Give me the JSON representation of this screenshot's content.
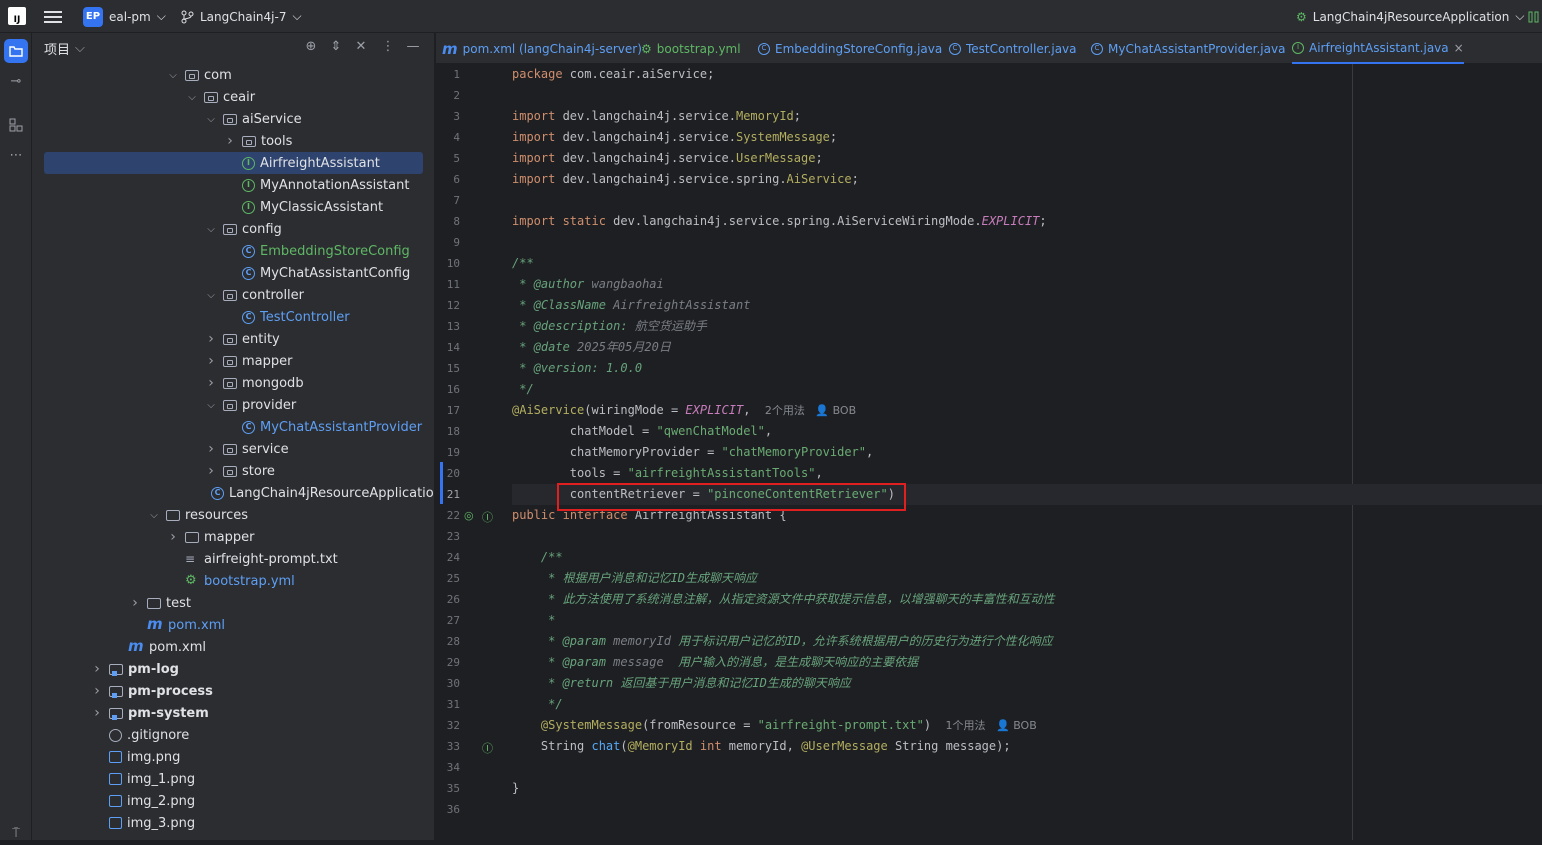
{
  "titlebar": {
    "logo": "IJ",
    "project_badge": "EP",
    "project_name": "eal-pm",
    "branch": "LangChain4j-7",
    "run_config": "LangChain4jResourceApplication"
  },
  "panel": {
    "title": "项目"
  },
  "tree": [
    {
      "label": "com",
      "type": "package",
      "indent": 1,
      "chev": "open"
    },
    {
      "label": "ceair",
      "type": "package",
      "indent": 2,
      "chev": "open"
    },
    {
      "label": "aiService",
      "type": "package",
      "indent": 3,
      "chev": "open"
    },
    {
      "label": "tools",
      "type": "package",
      "indent": 4,
      "chev": "closed"
    },
    {
      "label": "AirfreightAssistant",
      "type": "interface",
      "indent": 4,
      "chev": "none",
      "selected": true
    },
    {
      "label": "MyAnnotationAssistant",
      "type": "interface",
      "indent": 4,
      "chev": "none"
    },
    {
      "label": "MyClassicAssistant",
      "type": "interface",
      "indent": 4,
      "chev": "none"
    },
    {
      "label": "config",
      "type": "package",
      "indent": 3,
      "chev": "open"
    },
    {
      "label": "EmbeddingStoreConfig",
      "type": "class",
      "indent": 4,
      "chev": "none",
      "color": "green"
    },
    {
      "label": "MyChatAssistantConfig",
      "type": "class",
      "indent": 4,
      "chev": "none"
    },
    {
      "label": "controller",
      "type": "package",
      "indent": 3,
      "chev": "open"
    },
    {
      "label": "TestController",
      "type": "class",
      "indent": 4,
      "chev": "none",
      "color": "blue"
    },
    {
      "label": "entity",
      "type": "package",
      "indent": 3,
      "chev": "closed"
    },
    {
      "label": "mapper",
      "type": "package",
      "indent": 3,
      "chev": "closed"
    },
    {
      "label": "mongodb",
      "type": "package",
      "indent": 3,
      "chev": "closed"
    },
    {
      "label": "provider",
      "type": "package",
      "indent": 3,
      "chev": "open"
    },
    {
      "label": "MyChatAssistantProvider",
      "type": "class",
      "indent": 4,
      "chev": "none",
      "color": "blue"
    },
    {
      "label": "service",
      "type": "package",
      "indent": 3,
      "chev": "closed"
    },
    {
      "label": "store",
      "type": "package",
      "indent": 3,
      "chev": "closed"
    },
    {
      "label": "LangChain4jResourceApplication",
      "type": "class",
      "indent": 3,
      "chev": "none"
    },
    {
      "label": "resources",
      "type": "folder",
      "indent": 0,
      "chev": "open"
    },
    {
      "label": "mapper",
      "type": "folder",
      "indent": 1,
      "chev": "closed"
    },
    {
      "label": "airfreight-prompt.txt",
      "type": "txt",
      "indent": 1,
      "chev": "none"
    },
    {
      "label": "bootstrap.yml",
      "type": "yml",
      "indent": 1,
      "chev": "none",
      "color": "blue"
    },
    {
      "label": "test",
      "type": "folder",
      "indent": -1,
      "chev": "closed"
    },
    {
      "label": "pom.xml",
      "type": "maven",
      "indent": -1,
      "chev": "none",
      "color": "blue"
    },
    {
      "label": "pom.xml",
      "type": "maven",
      "indent": -2,
      "chev": "none"
    },
    {
      "label": "pm-log",
      "type": "module",
      "indent": -3,
      "chev": "closed",
      "bold": true
    },
    {
      "label": "pm-process",
      "type": "module",
      "indent": -3,
      "chev": "closed",
      "bold": true
    },
    {
      "label": "pm-system",
      "type": "module",
      "indent": -3,
      "chev": "closed",
      "bold": true
    },
    {
      "label": ".gitignore",
      "type": "git",
      "indent": -3,
      "chev": "none"
    },
    {
      "label": "img.png",
      "type": "image",
      "indent": -3,
      "chev": "none"
    },
    {
      "label": "img_1.png",
      "type": "image",
      "indent": -3,
      "chev": "none"
    },
    {
      "label": "img_2.png",
      "type": "image",
      "indent": -3,
      "chev": "none"
    },
    {
      "label": "img_3.png",
      "type": "image",
      "indent": -3,
      "chev": "none"
    }
  ],
  "tabs": [
    {
      "label": "pom.xml (langChain4j-server)",
      "icon": "maven"
    },
    {
      "label": "bootstrap.yml",
      "icon": "yml"
    },
    {
      "label": "EmbeddingStoreConfig.java",
      "icon": "class"
    },
    {
      "label": "TestController.java",
      "icon": "class"
    },
    {
      "label": "MyChatAssistantProvider.java",
      "icon": "class"
    },
    {
      "label": "AirfreightAssistant.java",
      "icon": "interface",
      "active": true
    }
  ],
  "code_lines": [
    [
      {
        "t": "package",
        "c": "kw"
      },
      {
        "t": " com.ceair.aiService;"
      }
    ],
    [],
    [
      {
        "t": "import",
        "c": "kw"
      },
      {
        "t": " dev.langchain4j.service."
      },
      {
        "t": "MemoryId",
        "c": "an"
      },
      {
        "t": ";"
      }
    ],
    [
      {
        "t": "import",
        "c": "kw"
      },
      {
        "t": " dev.langchain4j.service."
      },
      {
        "t": "SystemMessage",
        "c": "an"
      },
      {
        "t": ";"
      }
    ],
    [
      {
        "t": "import",
        "c": "kw"
      },
      {
        "t": " dev.langchain4j.service."
      },
      {
        "t": "UserMessage",
        "c": "an"
      },
      {
        "t": ";"
      }
    ],
    [
      {
        "t": "import",
        "c": "kw"
      },
      {
        "t": " dev.langchain4j.service.spring."
      },
      {
        "t": "AiService",
        "c": "an"
      },
      {
        "t": ";"
      }
    ],
    [],
    [
      {
        "t": "import static",
        "c": "kw"
      },
      {
        "t": " dev.langchain4j.service.spring.AiServiceWiringMode."
      },
      {
        "t": "EXPLICIT",
        "c": "it"
      },
      {
        "t": ";"
      }
    ],
    [],
    [
      {
        "t": "/**",
        "c": "cd"
      }
    ],
    [
      {
        "t": " * ",
        "c": "cd"
      },
      {
        "t": "@author",
        "c": "cd"
      },
      {
        "t": " wangbaohai",
        "c": "cm"
      }
    ],
    [
      {
        "t": " * ",
        "c": "cd"
      },
      {
        "t": "@ClassName",
        "c": "cd"
      },
      {
        "t": " AirfreightAssistant",
        "c": "cm"
      }
    ],
    [
      {
        "t": " * ",
        "c": "cd"
      },
      {
        "t": "@description:",
        "c": "cd"
      },
      {
        "t": " 航空货运助手",
        "c": "cm"
      }
    ],
    [
      {
        "t": " * ",
        "c": "cd"
      },
      {
        "t": "@date",
        "c": "cd"
      },
      {
        "t": " 2025年05月20日",
        "c": "cm"
      }
    ],
    [
      {
        "t": " * ",
        "c": "cd"
      },
      {
        "t": "@version:",
        "c": "cd"
      },
      {
        "t": " 1.0.0",
        "c": "cd"
      }
    ],
    [
      {
        "t": " */",
        "c": "cd"
      }
    ],
    [
      {
        "t": "@AiService",
        "c": "an"
      },
      {
        "t": "(wiringMode = "
      },
      {
        "t": "EXPLICIT",
        "c": "it"
      },
      {
        "t": ",  "
      },
      {
        "t": "2个用法   👤 BOB",
        "c": "inlay"
      }
    ],
    [
      {
        "t": "        chatModel = "
      },
      {
        "t": "\"qwenChatModel\"",
        "c": "st"
      },
      {
        "t": ","
      }
    ],
    [
      {
        "t": "        chatMemoryProvider = "
      },
      {
        "t": "\"chatMemoryProvider\"",
        "c": "st"
      },
      {
        "t": ","
      }
    ],
    [
      {
        "t": "        tools = "
      },
      {
        "t": "\"airfreightAssistantTools\"",
        "c": "st"
      },
      {
        "t": ","
      }
    ],
    [
      {
        "t": "        contentRetriever = "
      },
      {
        "t": "\"pinconeContentRetriever\"",
        "c": "st"
      },
      {
        "t": ")"
      }
    ],
    [
      {
        "t": "public",
        "c": "kw"
      },
      {
        "t": " "
      },
      {
        "t": "interface",
        "c": "kw"
      },
      {
        "t": " AirfreightAssistant {"
      }
    ],
    [],
    [
      {
        "t": "    /**",
        "c": "cd"
      }
    ],
    [
      {
        "t": "     * 根据用户消息和记忆ID生成聊天响应",
        "c": "cd"
      }
    ],
    [
      {
        "t": "     * 此方法使用了系统消息注解，从指定资源文件中获取提示信息，以增强聊天的丰富性和互动性",
        "c": "cd"
      }
    ],
    [
      {
        "t": "     *",
        "c": "cd"
      }
    ],
    [
      {
        "t": "     * ",
        "c": "cd"
      },
      {
        "t": "@param",
        "c": "cd"
      },
      {
        "t": " memoryId",
        "c": "cm"
      },
      {
        "t": " 用于标识用户记忆的ID，允许系统根据用户的历史行为进行个性化响应",
        "c": "cd"
      }
    ],
    [
      {
        "t": "     * ",
        "c": "cd"
      },
      {
        "t": "@param",
        "c": "cd"
      },
      {
        "t": " message",
        "c": "cm"
      },
      {
        "t": "  用户输入的消息，是生成聊天响应的主要依据",
        "c": "cd"
      }
    ],
    [
      {
        "t": "     * ",
        "c": "cd"
      },
      {
        "t": "@return",
        "c": "cd"
      },
      {
        "t": " 返回基于用户消息和记忆ID生成的聊天响应",
        "c": "cd"
      }
    ],
    [
      {
        "t": "     */",
        "c": "cd"
      }
    ],
    [
      {
        "t": "    "
      },
      {
        "t": "@SystemMessage",
        "c": "an"
      },
      {
        "t": "(fromResource = "
      },
      {
        "t": "\"airfreight-prompt.txt\"",
        "c": "st"
      },
      {
        "t": ")  "
      },
      {
        "t": "1个用法   👤 BOB",
        "c": "inlay"
      }
    ],
    [
      {
        "t": "    String "
      },
      {
        "t": "chat",
        "c": "fn"
      },
      {
        "t": "("
      },
      {
        "t": "@MemoryId",
        "c": "an"
      },
      {
        "t": " "
      },
      {
        "t": "int",
        "c": "kw"
      },
      {
        "t": " memoryId, "
      },
      {
        "t": "@UserMessage",
        "c": "an"
      },
      {
        "t": " String message);"
      }
    ],
    [],
    [
      {
        "t": "}"
      }
    ],
    []
  ],
  "current_line": 21,
  "colors": {
    "accent": "#3574f0",
    "highlight_box": "#e02020"
  }
}
